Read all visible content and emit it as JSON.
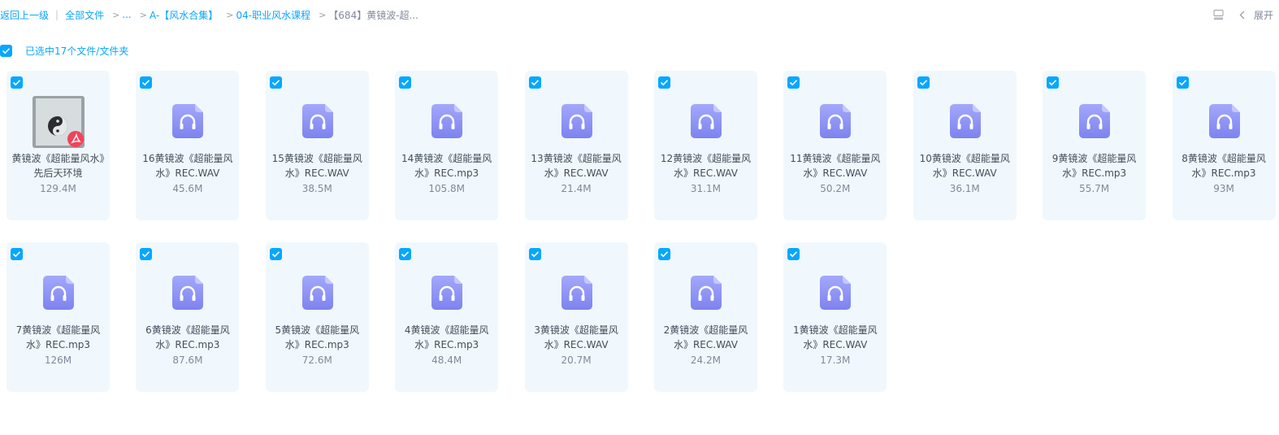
{
  "breadcrumb": {
    "back": "返回上一级",
    "root": "全部文件",
    "ellipsis": "...",
    "folder1": "A-【风水合集】",
    "folder2": "04-职业风水课程",
    "current": "【684】黄镜波-超..."
  },
  "toolbar": {
    "view_icon": "list-view-icon",
    "expand_label": "展开"
  },
  "selection": {
    "text": "已选中17个文件/文件夹"
  },
  "colors": {
    "accent": "#06a7ff",
    "card_bg": "#f0f8fd",
    "audio_icon": "#8a8ff5",
    "pdf_badge": "#f0445a"
  },
  "files": [
    {
      "name": "黄镜波《超能量风水》先后天环境",
      "size": "129.4M",
      "type": "pdf"
    },
    {
      "name": "16黄镜波《超能量风水》REC.WAV",
      "size": "45.6M",
      "type": "audio"
    },
    {
      "name": "15黄镜波《超能量风水》REC.WAV",
      "size": "38.5M",
      "type": "audio"
    },
    {
      "name": "14黄镜波《超能量风水》REC.mp3",
      "size": "105.8M",
      "type": "audio"
    },
    {
      "name": "13黄镜波《超能量风水》REC.WAV",
      "size": "21.4M",
      "type": "audio"
    },
    {
      "name": "12黄镜波《超能量风水》REC.WAV",
      "size": "31.1M",
      "type": "audio"
    },
    {
      "name": "11黄镜波《超能量风水》REC.WAV",
      "size": "50.2M",
      "type": "audio"
    },
    {
      "name": "10黄镜波《超能量风水》REC.WAV",
      "size": "36.1M",
      "type": "audio"
    },
    {
      "name": "9黄镜波《超能量风水》REC.mp3",
      "size": "55.7M",
      "type": "audio"
    },
    {
      "name": "8黄镜波《超能量风水》REC.mp3",
      "size": "93M",
      "type": "audio"
    },
    {
      "name": "7黄镜波《超能量风水》REC.mp3",
      "size": "126M",
      "type": "audio"
    },
    {
      "name": "6黄镜波《超能量风水》REC.mp3",
      "size": "87.6M",
      "type": "audio"
    },
    {
      "name": "5黄镜波《超能量风水》REC.mp3",
      "size": "72.6M",
      "type": "audio"
    },
    {
      "name": "4黄镜波《超能量风水》REC.mp3",
      "size": "48.4M",
      "type": "audio"
    },
    {
      "name": "3黄镜波《超能量风水》REC.WAV",
      "size": "20.7M",
      "type": "audio"
    },
    {
      "name": "2黄镜波《超能量风水》REC.WAV",
      "size": "24.2M",
      "type": "audio"
    },
    {
      "name": "1黄镜波《超能量风水》REC.WAV",
      "size": "17.3M",
      "type": "audio"
    }
  ]
}
